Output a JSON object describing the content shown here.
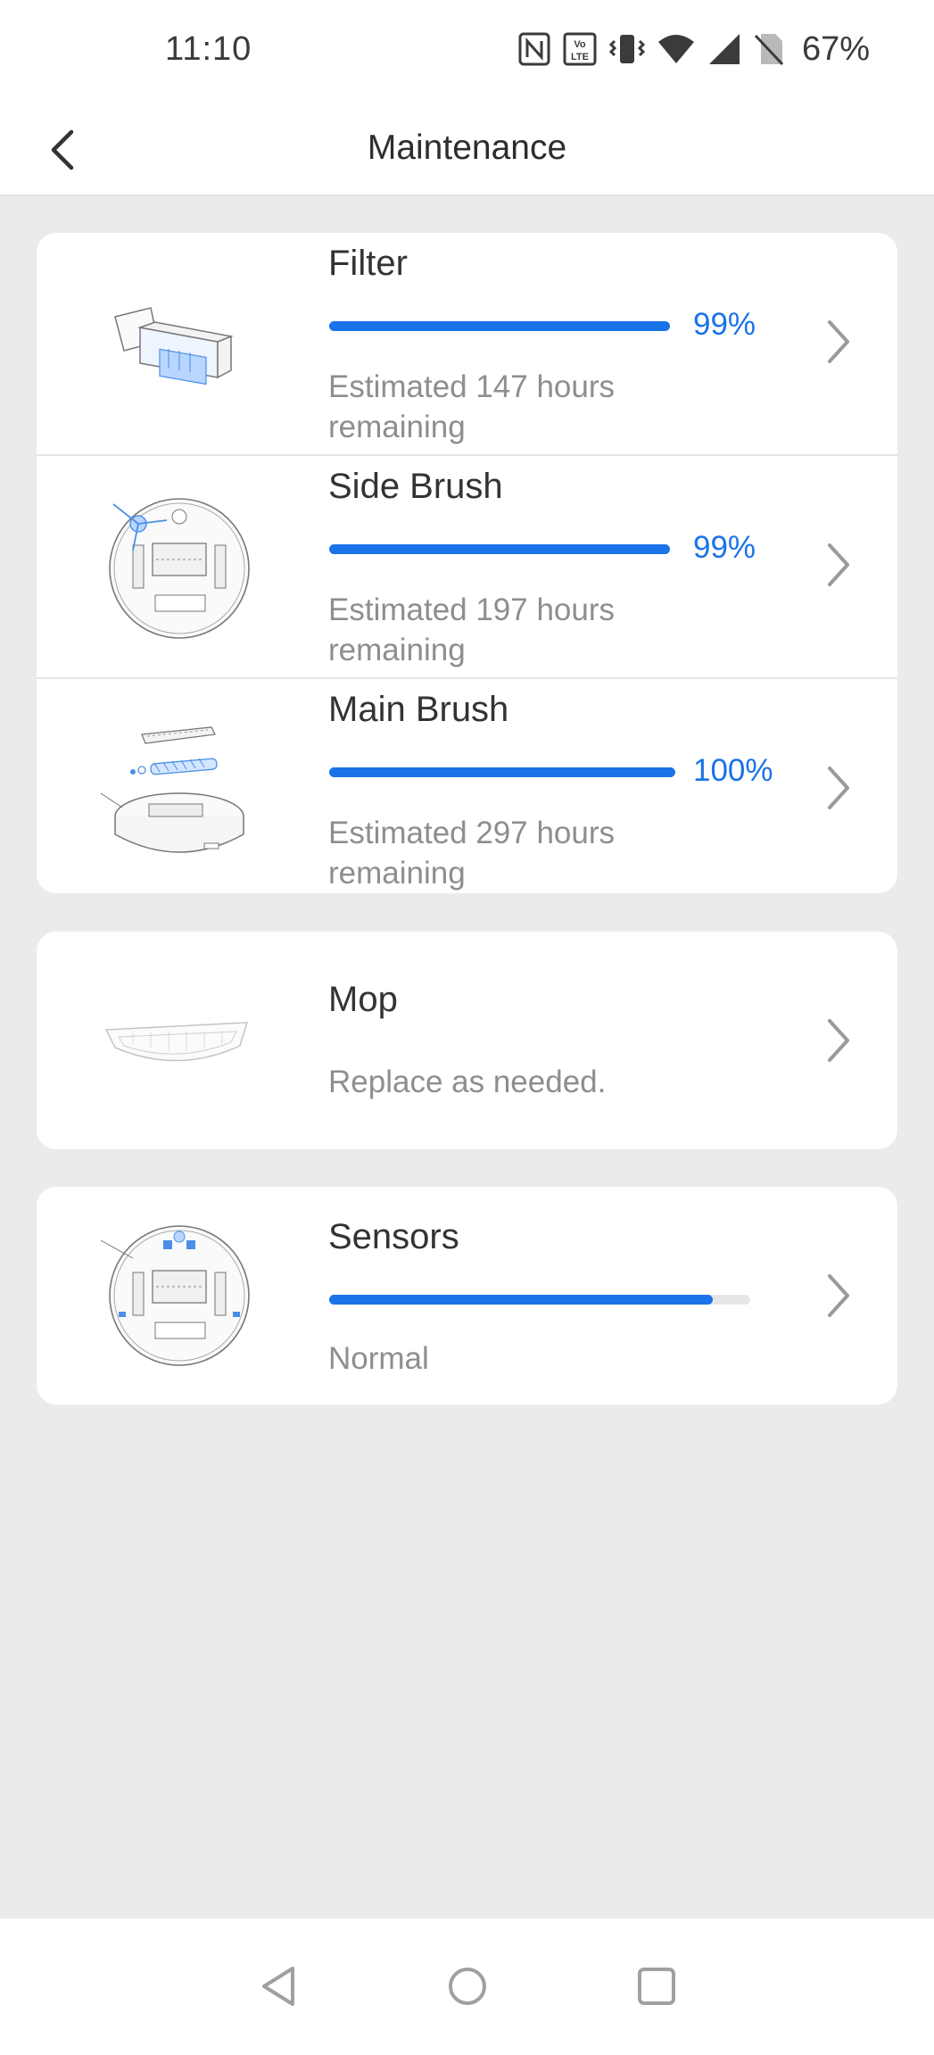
{
  "status_bar": {
    "time": "11:10",
    "icons": [
      "nfc-icon",
      "volte-icon",
      "vibrate-icon",
      "wifi-icon",
      "signal-icon",
      "no-sim-icon"
    ],
    "battery": "67%"
  },
  "header": {
    "back_icon": "back-arrow-icon",
    "title": "Maintenance"
  },
  "groups": [
    {
      "items": [
        {
          "name": "Filter",
          "progress_percent": 99,
          "percent_label": "99%",
          "description": "Estimated 147 hours remaining",
          "image": "filter-illustration"
        },
        {
          "name": "Side Brush",
          "progress_percent": 99,
          "percent_label": "99%",
          "description": "Estimated 197 hours remaining",
          "image": "side-brush-illustration"
        },
        {
          "name": "Main Brush",
          "progress_percent": 100,
          "percent_label": "100%",
          "description": "Estimated 297 hours remaining",
          "image": "main-brush-illustration"
        }
      ]
    },
    {
      "items": [
        {
          "name": "Mop",
          "description": "Replace as needed.",
          "image": "mop-illustration"
        }
      ]
    },
    {
      "items": [
        {
          "name": "Sensors",
          "progress_percent": 91,
          "description": "Normal",
          "image": "sensors-illustration"
        }
      ]
    }
  ],
  "colors": {
    "accent": "#1a73e8",
    "background": "#ebebeb",
    "card": "#ffffff",
    "secondary_text": "#8e8e8e"
  },
  "nav_bar": {
    "icons": [
      "nav-back-icon",
      "nav-home-icon",
      "nav-recents-icon"
    ]
  }
}
